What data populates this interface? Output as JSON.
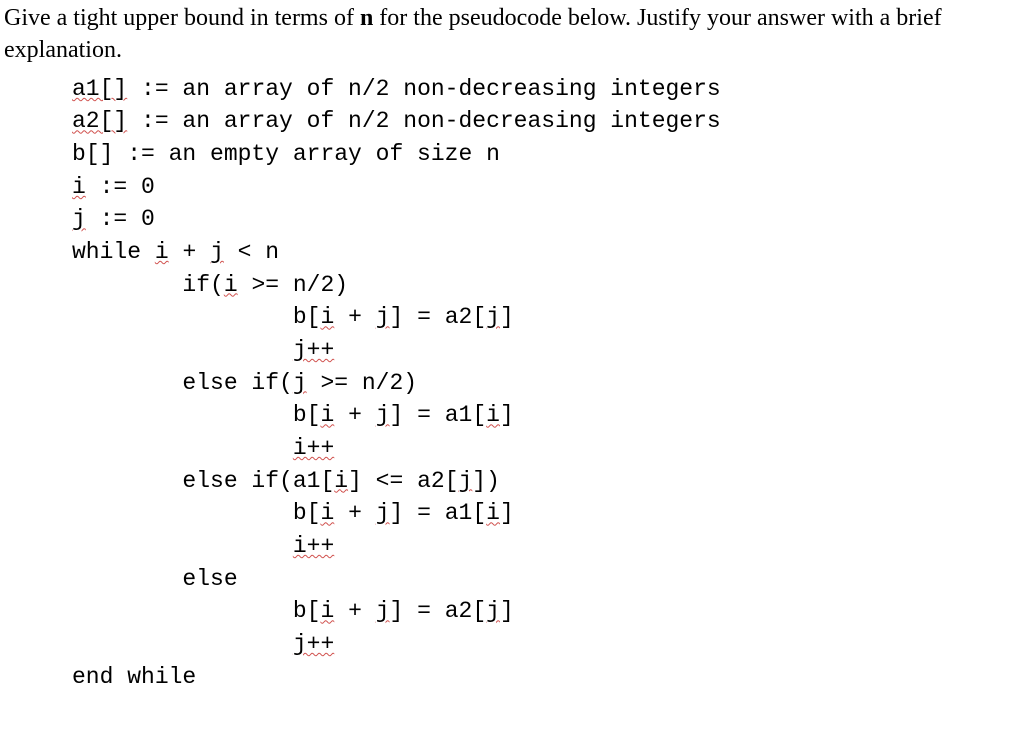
{
  "prompt": {
    "pre": "Give a tight upper bound in terms of ",
    "bold": "n",
    "post": " for the pseudocode below. Justify your answer with a brief explanation."
  },
  "code": {
    "l01a": "a1[]",
    "l01b": " := an array of n/2 non-decreasing integers",
    "l02a": "a2[]",
    "l02b": " := an array of n/2 non-decreasing integers",
    "l03": "b[] := an empty array of size n",
    "l04a": "i",
    "l04b": " := 0",
    "l05a": "j",
    "l05b": " := 0",
    "l06a": "while ",
    "l06b": "i",
    "l06c": " + ",
    "l06d": "j",
    "l06e": " < n",
    "l07a": "        if(",
    "l07b": "i",
    "l07c": " >= n/2)",
    "l08a": "                b[",
    "l08b": "i",
    "l08c": " + ",
    "l08d": "j",
    "l08e": "] = a2[",
    "l08f": "j",
    "l08g": "]",
    "l09a": "                ",
    "l09b": "j++",
    "l10a": "        else if(",
    "l10b": "j",
    "l10c": " >= n/2)",
    "l11a": "                b[",
    "l11b": "i",
    "l11c": " + ",
    "l11d": "j",
    "l11e": "] = a1[",
    "l11f": "i",
    "l11g": "]",
    "l12a": "                ",
    "l12b": "i++",
    "l13a": "        else if(a1[",
    "l13b": "i",
    "l13c": "] <= a2[",
    "l13d": "j",
    "l13e": "])",
    "l14a": "                b[",
    "l14b": "i",
    "l14c": " + ",
    "l14d": "j",
    "l14e": "] = a1[",
    "l14f": "i",
    "l14g": "]",
    "l15a": "                ",
    "l15b": "i++",
    "l16": "        else",
    "l17a": "                b[",
    "l17b": "i",
    "l17c": " + ",
    "l17d": "j",
    "l17e": "] = a2[",
    "l17f": "j",
    "l17g": "]",
    "l18a": "                ",
    "l18b": "j++",
    "l19": "end while"
  }
}
